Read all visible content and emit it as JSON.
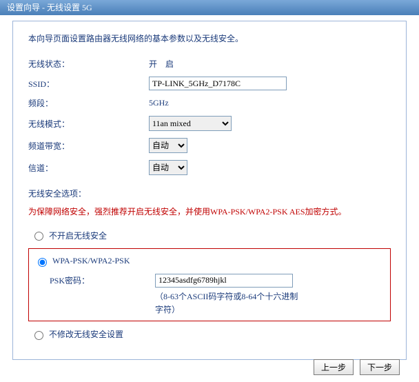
{
  "titlebar": "设置向导 - 无线设置 5G",
  "intro": "本向导页面设置路由器无线网络的基本参数以及无线安全。",
  "fields": {
    "status_label": "无线状态：",
    "status_value": "开　启",
    "ssid_label": "SSID：",
    "ssid_value": "TP-LINK_5GHz_D7178C",
    "band_label": "频段：",
    "band_value": "5GHz",
    "mode_label": "无线模式：",
    "mode_value": "11an mixed",
    "bw_label": "频道带宽：",
    "bw_value": "自动",
    "chan_label": "信道：",
    "chan_value": "自动"
  },
  "security": {
    "section_label": "无线安全选项：",
    "warning": "为保障网络安全，强烈推荐开启无线安全，并使用WPA-PSK/WPA2-PSK AES加密方式。",
    "opt_none": "不开启无线安全",
    "opt_psk": "WPA-PSK/WPA2-PSK",
    "psk_label": "PSK密码：",
    "psk_value": "12345asdfg6789hjkl",
    "psk_hint": "（8-63个ASCII码字符或8-64个十六进制字符）",
    "opt_nochange": "不修改无线安全设置"
  },
  "footer": {
    "prev": "上一步",
    "next": "下一步"
  }
}
